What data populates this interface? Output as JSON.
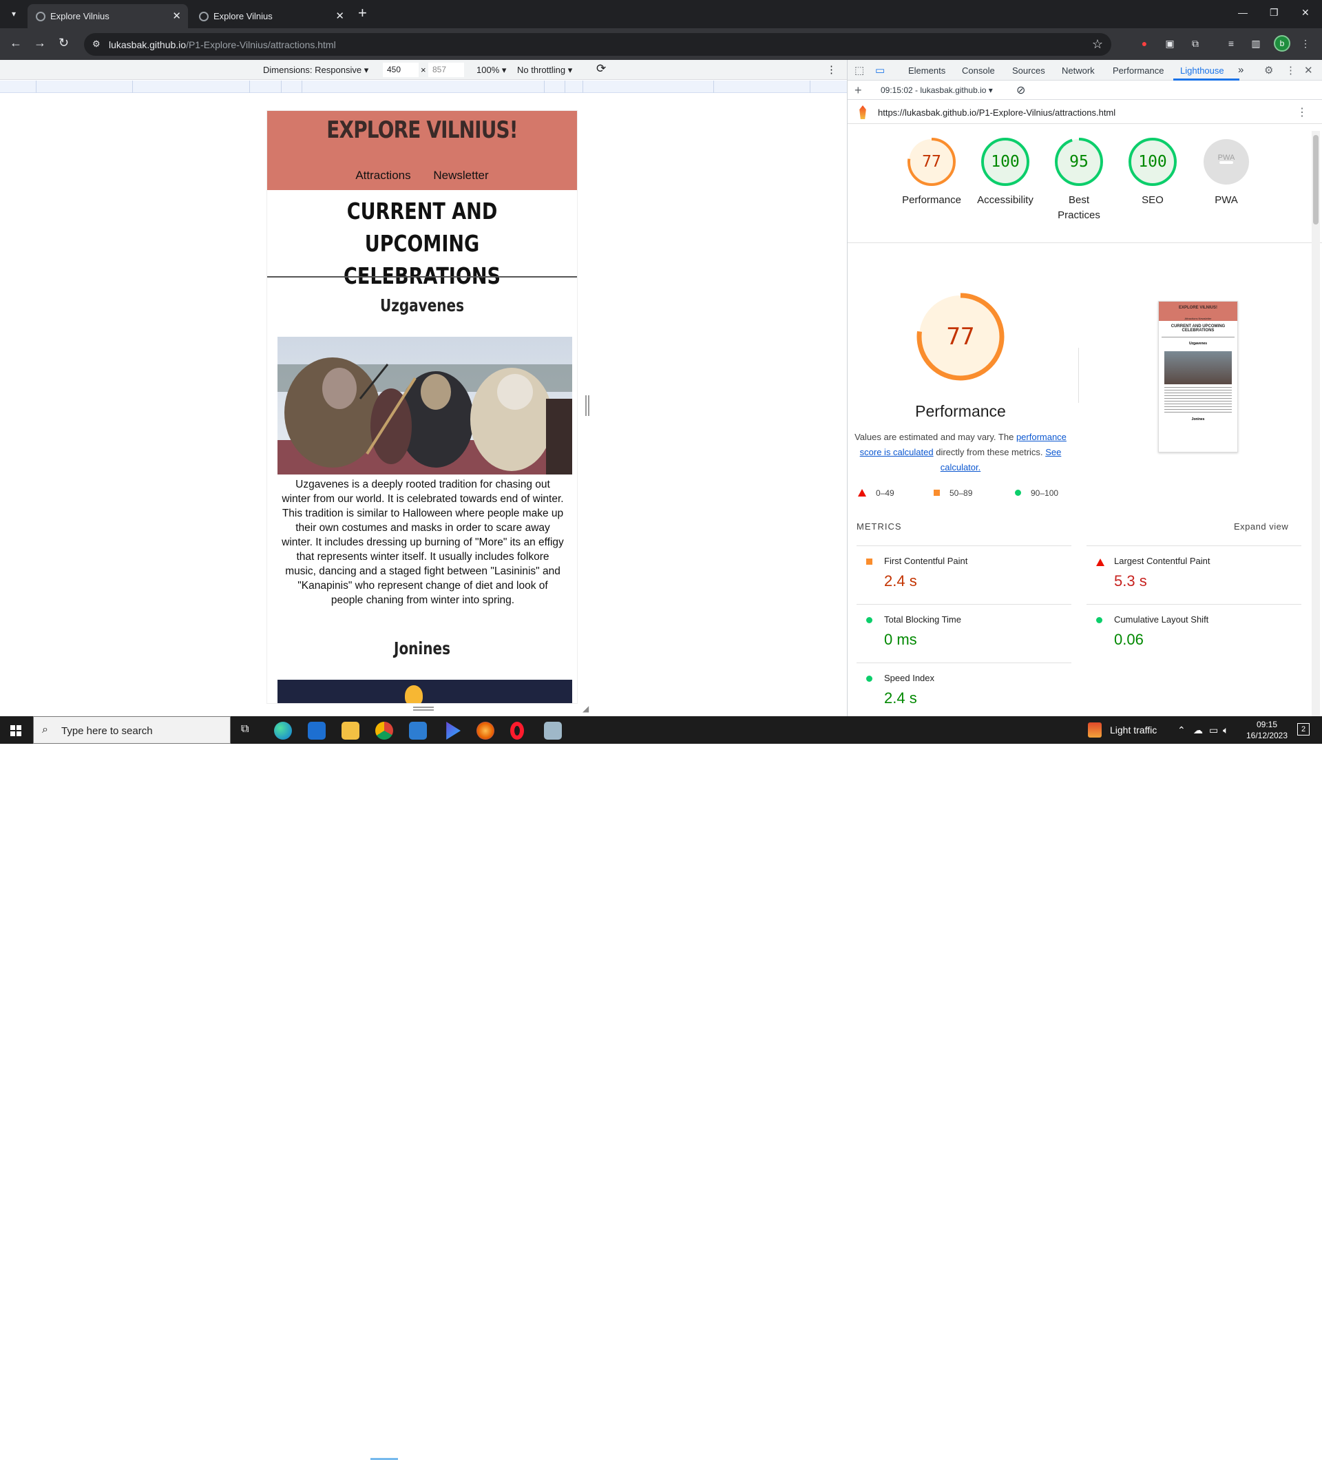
{
  "browser": {
    "tabs": [
      {
        "title": "Explore Vilnius",
        "active": true
      },
      {
        "title": "Explore Vilnius",
        "active": false
      }
    ],
    "url_host": "lukasbak.github.io",
    "url_path": "/P1-Explore-Vilnius/attractions.html",
    "avatar_letter": "b"
  },
  "device_toolbar": {
    "dimensions_label": "Dimensions: Responsive",
    "width": "450",
    "times": "×",
    "height": "857",
    "zoom": "100%",
    "throttling": "No throttling"
  },
  "site": {
    "title": "EXPLORE VILNIUS!",
    "nav": [
      "Attractions",
      "Newsletter"
    ],
    "heading_line1": "CURRENT AND UPCOMING",
    "heading_line2": "CELEBRATIONS",
    "section1_title": "Uzgavenes",
    "section1_text": "Uzgavenes is a deeply rooted tradition for chasing out winter from our world. It is celebrated towards end of winter. This tradition is similar to Halloween where people make up their own costumes and masks in order to scare away winter. It includes dressing up burning of \"More\" its an effigy that represents winter itself. It usually includes folkore music, dancing and a staged fight between \"Lasininis\" and \"Kanapinis\" who represent change of diet and look of people chaning from winter into spring.",
    "section2_title": "Jonines"
  },
  "devtools": {
    "tabs": [
      "Elements",
      "Console",
      "Sources",
      "Network",
      "Performance",
      "Lighthouse"
    ],
    "active_tab": "Lighthouse",
    "report_selector": "09:15:02 - lukasbak.github.io",
    "report_url": "https://lukasbak.github.io/P1-Explore-Vilnius/attractions.html",
    "scores": [
      {
        "label": "Performance",
        "value": "77",
        "score": 0.77,
        "color": "#fa8d2d",
        "text_color": "#c33300",
        "bg": "#fff3e0"
      },
      {
        "label": "Accessibility",
        "value": "100",
        "score": 1.0,
        "color": "#0cce6b",
        "text_color": "#008800",
        "bg": "#e8f5e9"
      },
      {
        "label": "Best Practices",
        "value": "95",
        "score": 0.95,
        "color": "#0cce6b",
        "text_color": "#008800",
        "bg": "#e8f5e9"
      },
      {
        "label": "SEO",
        "value": "100",
        "score": 1.0,
        "color": "#0cce6b",
        "text_color": "#008800",
        "bg": "#e8f5e9"
      },
      {
        "label": "PWA",
        "value": "PWA",
        "score": 0,
        "color": "#e0e0e0",
        "text_color": "#9e9e9e",
        "bg": "#e0e0e0"
      }
    ],
    "perf_title": "Performance",
    "perf_score": "77",
    "note_a": "Values are estimated and may vary. The",
    "note_link1": "performance score is calculated",
    "note_b": "directly from these metrics.",
    "note_link2": "See calculator.",
    "legend": [
      "0–49",
      "50–89",
      "90–100"
    ],
    "metrics_title": "METRICS",
    "expand_label": "Expand view",
    "metrics": [
      {
        "name": "First Contentful Paint",
        "value": "2.4 s",
        "status": "average"
      },
      {
        "name": "Largest Contentful Paint",
        "value": "5.3 s",
        "status": "fail"
      },
      {
        "name": "Total Blocking Time",
        "value": "0 ms",
        "status": "pass"
      },
      {
        "name": "Cumulative Layout Shift",
        "value": "0.06",
        "status": "pass"
      },
      {
        "name": "Speed Index",
        "value": "2.4 s",
        "status": "pass"
      }
    ],
    "thumb": {
      "title": "EXPLORE VILNIUS!",
      "nav": "Attractions Newsletter",
      "heading": "CURRENT AND UPCOMING CELEBRATIONS",
      "section": "Uzgavenes",
      "section2": "Jonines"
    }
  },
  "taskbar": {
    "search_placeholder": "Type here to search",
    "traffic": "Light traffic",
    "time": "09:15",
    "date": "16/12/2023",
    "notifications": "2"
  },
  "colors": {
    "header_bg": "#d4786a",
    "lighthouse_blue": "#1a73e8"
  }
}
